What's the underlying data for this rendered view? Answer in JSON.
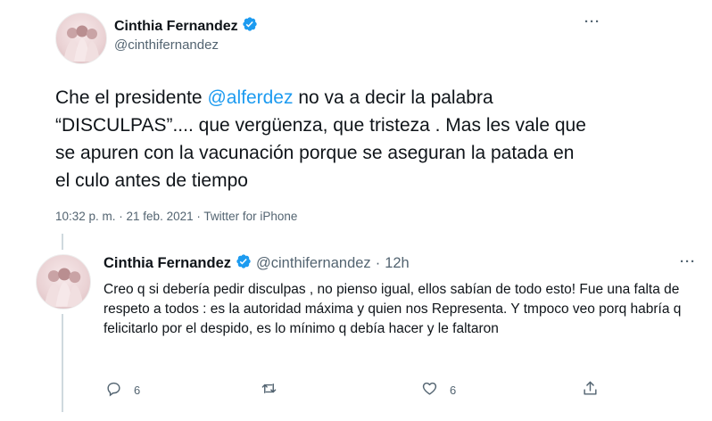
{
  "main_tweet": {
    "author_name": "Cinthia Fernandez",
    "author_handle": "@cinthifernandez",
    "more_label": "···",
    "text_before": "Che el presidente ",
    "mention": "@alferdez",
    "text_after": " no va a decir la palabra “DISCULPAS”.... que vergüenza, que tristeza . Mas les vale que se apuren con la vacunación porque se aseguran la patada en el culo antes de tiempo",
    "meta": "10:32 p. m. · 21 feb. 2021 · Twitter for iPhone"
  },
  "reply_tweet": {
    "author_name": "Cinthia Fernandez",
    "author_handle": "@cinthifernandez",
    "separator": "·",
    "time": "12h",
    "more_label": "···",
    "text": "Creo q si debería pedir disculpas , no pienso igual, ellos sabían de todo esto! Fue una falta de respeto a todos : es la autoridad máxima y quien nos Representa. Y tmpoco veo porq habría q felicitarlo por el despido, es lo mínimo q debía hacer y le faltaron",
    "actions": {
      "reply_count": "6",
      "retweet_count": "",
      "like_count": "6"
    }
  },
  "colors": {
    "accent": "#1d9bf0",
    "secondary_text": "#536471",
    "thread_line": "#cfd9de"
  },
  "icons": [
    "verified-badge-icon",
    "more-icon",
    "reply-icon",
    "retweet-icon",
    "like-icon",
    "share-icon"
  ]
}
